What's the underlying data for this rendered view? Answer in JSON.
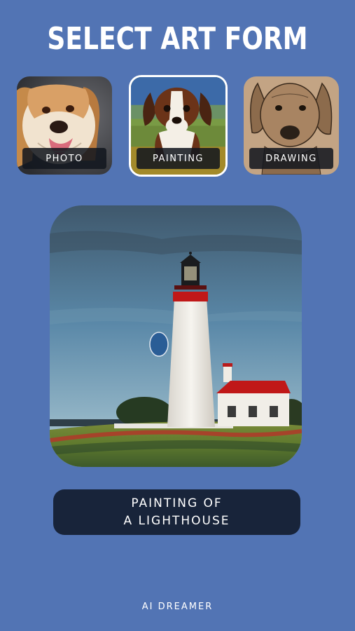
{
  "header": {
    "title": "SELECT ART FORM"
  },
  "art_forms": [
    {
      "label": "PHOTO",
      "selected": false
    },
    {
      "label": "PAINTING",
      "selected": true
    },
    {
      "label": "DRAWING",
      "selected": false
    }
  ],
  "preview": {
    "caption_line1": "PAINTING OF",
    "caption_line2": "A LIGHTHOUSE"
  },
  "footer": {
    "brand": "AI DREAMER"
  },
  "colors": {
    "background": "#5274b4",
    "caption_bg": "#18243a",
    "selected_border": "#ffffff"
  }
}
